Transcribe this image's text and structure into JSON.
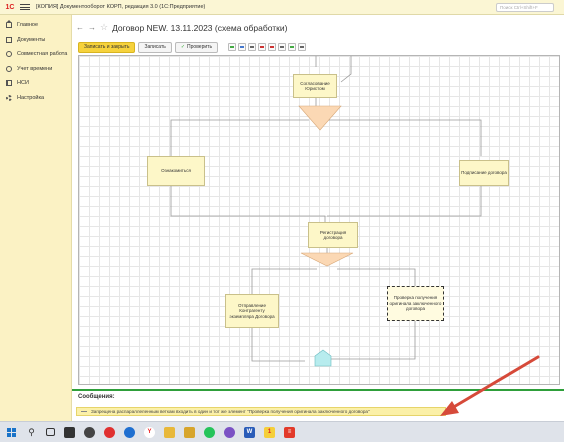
{
  "app": {
    "logo": "1С",
    "title": "[КОПИЯ] Документооборот КОРП, редакция 3.0  (1С:Предприятие)",
    "search_placeholder": "Поиск Ctrl+Shift+F"
  },
  "sidebar": {
    "items": [
      {
        "label": "Главное",
        "icon": "home-icon"
      },
      {
        "label": "Документы",
        "icon": "document-icon"
      },
      {
        "label": "Совместная работа",
        "icon": "team-icon"
      },
      {
        "label": "Учет времени",
        "icon": "clock-icon"
      },
      {
        "label": "НСИ",
        "icon": "book-icon"
      },
      {
        "label": "Настройка",
        "icon": "gear-icon"
      }
    ]
  },
  "header": {
    "back": "←",
    "forward": "→",
    "star": "☆",
    "title": "Договор NEW. 13.11.2023 (схема обработки)"
  },
  "toolbar": {
    "save_close": "Записать и закрыть",
    "save": "Записать",
    "check": "Проверить"
  },
  "diagram": {
    "nodes": {
      "soglasovanie": "Согласование Юристом",
      "oznakomitsya": "Ознакомиться",
      "podpisanie": "Подписание договора",
      "registraciya": "Регистрация договора",
      "otpravka": "Отправление Контрагенту экземпляра Договора",
      "proverka": "Проверка получения оригинала заключенного договора"
    }
  },
  "messages": {
    "title": "Сообщения:",
    "items": [
      "Запрещена распараллеленным веткам входить в один и тот же элемент \"Проверка получения оригинала заключенного договора\""
    ]
  },
  "colors": {
    "titlebar": "#fbf6d4",
    "sidebar": "#fbf2c4",
    "primary_button": "#f6d23c",
    "node_fill": "#fdf7c8",
    "condition_fill": "#fbd8b4",
    "end_fill": "#b7ecee",
    "messages_divider": "#2e9f3a",
    "annotation_arrow": "#d64a3a"
  },
  "taskbar": {
    "icons": [
      "start-icon",
      "search-icon",
      "task-view-icon",
      "file-explorer-icon",
      "app-icon",
      "record-icon",
      "media-icon",
      "yandex-browser-icon",
      "folder-icon",
      "folder-icon",
      "whatsapp-icon",
      "viber-icon",
      "word-icon",
      "1c-icon",
      "1c-app-icon"
    ]
  }
}
